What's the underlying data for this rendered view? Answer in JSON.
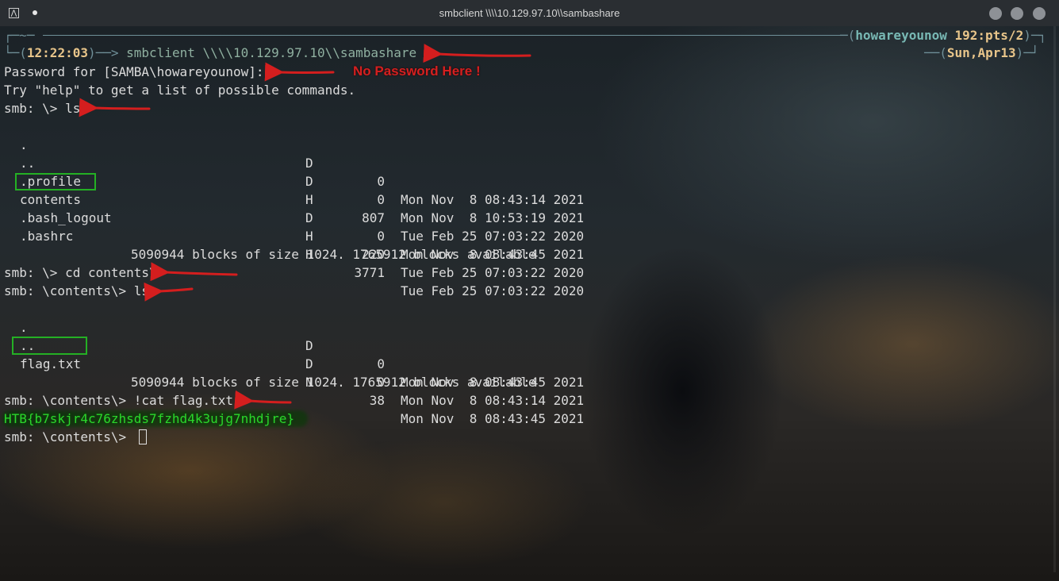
{
  "window": {
    "title": "smbclient \\\\\\\\10.129.97.10\\\\sambashare"
  },
  "prompt": {
    "top_left": "~",
    "time": "12:22:03",
    "user": "howareyounow",
    "pts": "192:pts/2",
    "date": "Sun,Apr13",
    "command": "smbclient \\\\\\\\10.129.97.10\\\\sambashare"
  },
  "lines": {
    "password": "Password for [SAMBA\\howareyounow]:",
    "help": "Try \"help\" to get a list of possible commands.",
    "ls1": "smb: \\> ls",
    "blocks": "5090944 blocks of size 1024. 1765912 blocks available",
    "cd": "smb: \\> cd contents\\",
    "ls2": "smb: \\contents\\> ls",
    "cat": "smb: \\contents\\> !cat flag.txt",
    "flag": "HTB{b7skjr4c76zhsds7fzhd4k3ujg7nhdjre}",
    "final_prompt": "smb: \\contents\\> "
  },
  "listing1": [
    {
      "name": ".",
      "attr": "D",
      "size": "0",
      "date": "Mon Nov  8 08:43:14 2021"
    },
    {
      "name": "..",
      "attr": "D",
      "size": "0",
      "date": "Mon Nov  8 10:53:19 2021"
    },
    {
      "name": ".profile",
      "attr": "H",
      "size": "807",
      "date": "Tue Feb 25 07:03:22 2020"
    },
    {
      "name": "contents",
      "attr": "D",
      "size": "0",
      "date": "Mon Nov  8 08:43:45 2021"
    },
    {
      "name": ".bash_logout",
      "attr": "H",
      "size": "220",
      "date": "Tue Feb 25 07:03:22 2020"
    },
    {
      "name": ".bashrc",
      "attr": "H",
      "size": "3771",
      "date": "Tue Feb 25 07:03:22 2020"
    }
  ],
  "listing2": [
    {
      "name": ".",
      "attr": "D",
      "size": "0",
      "date": "Mon Nov  8 08:43:45 2021"
    },
    {
      "name": "..",
      "attr": "D",
      "size": "0",
      "date": "Mon Nov  8 08:43:14 2021"
    },
    {
      "name": "flag.txt",
      "attr": "N",
      "size": "38",
      "date": "Mon Nov  8 08:43:45 2021"
    }
  ],
  "annotation": {
    "no_password": "No Password Here !",
    "arrow_color": "#d41e1e",
    "box_color": "#24b024"
  },
  "colors": {
    "flag": "#2bd62b",
    "time": "#e8c58a",
    "user": "#78b8b4"
  },
  "icons": [
    "app-icon",
    "close-icon",
    "maximize-icon",
    "minimize-icon"
  ]
}
